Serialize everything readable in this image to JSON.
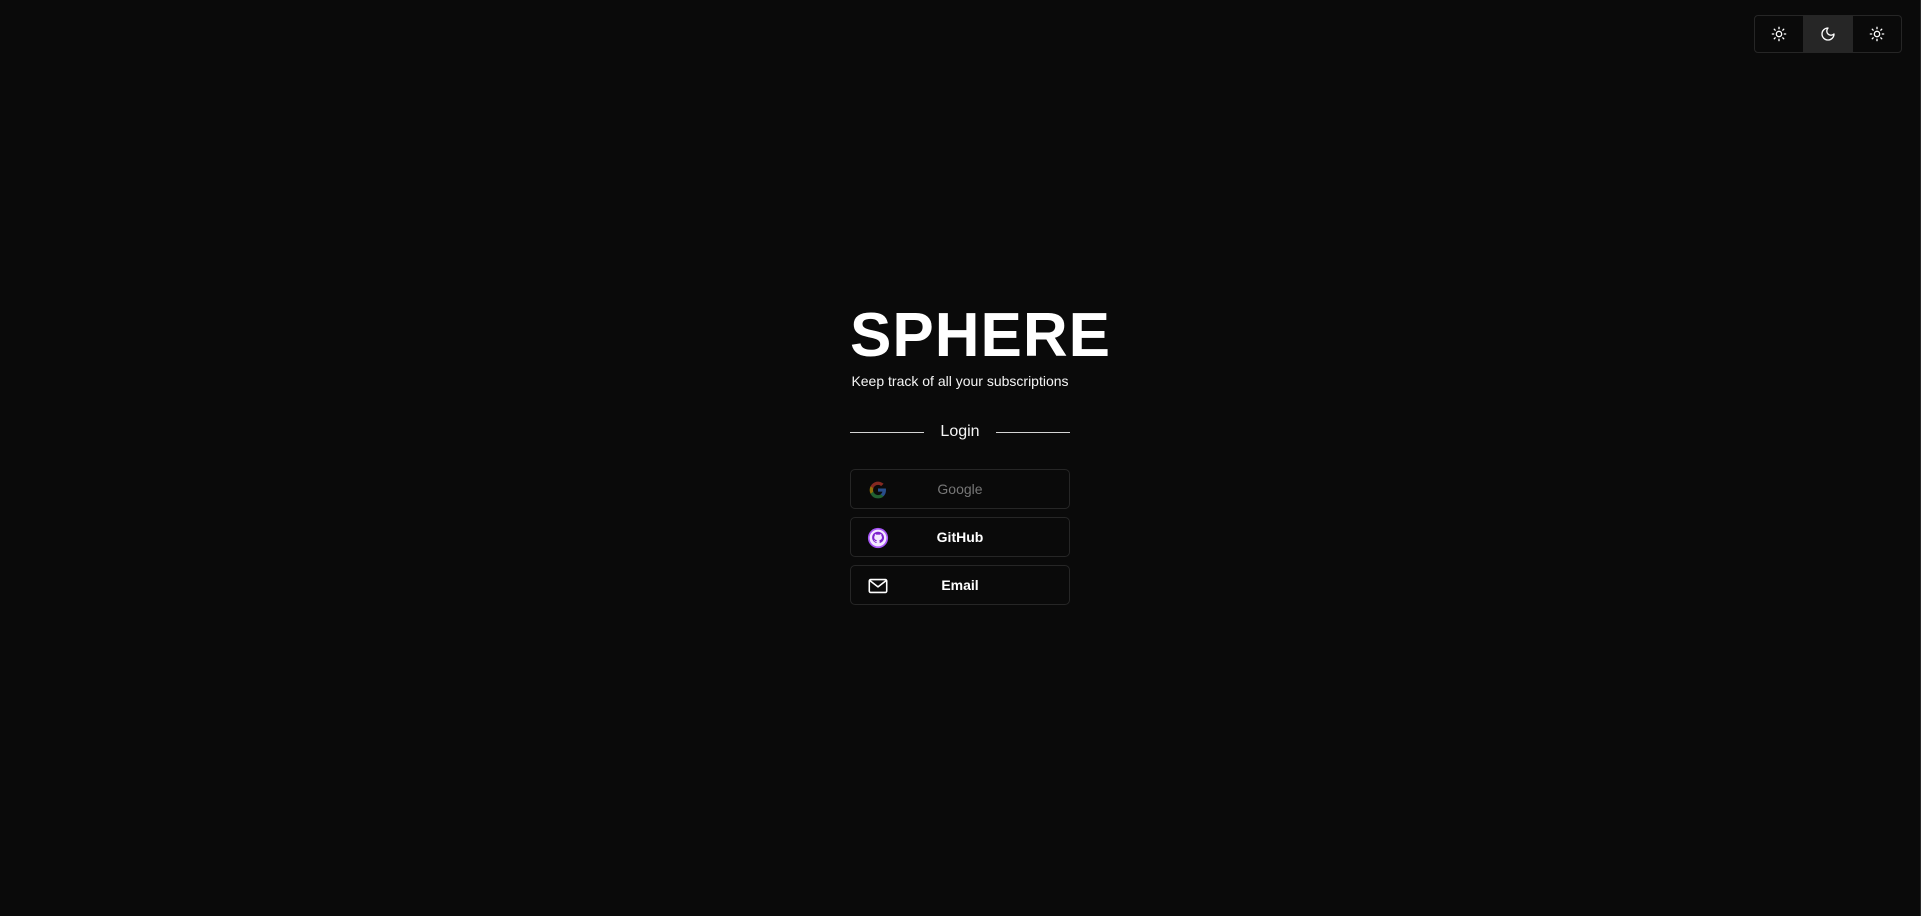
{
  "theme_switcher": {
    "options": [
      {
        "icon": "sun-icon",
        "active": false
      },
      {
        "icon": "moon-icon",
        "active": true
      },
      {
        "icon": "sun-system-icon",
        "active": false
      }
    ]
  },
  "brand": {
    "title": "SPHERE",
    "tagline": "Keep track of all your subscriptions"
  },
  "login": {
    "section_label": "Login",
    "providers": [
      {
        "label": "Google",
        "icon": "google-icon",
        "disabled": true
      },
      {
        "label": "GitHub",
        "icon": "github-icon",
        "disabled": false
      },
      {
        "label": "Email",
        "icon": "mail-icon",
        "disabled": false
      }
    ]
  },
  "colors": {
    "background": "#0a0a0a",
    "border": "#262626",
    "github_accent": "#a855f7"
  }
}
